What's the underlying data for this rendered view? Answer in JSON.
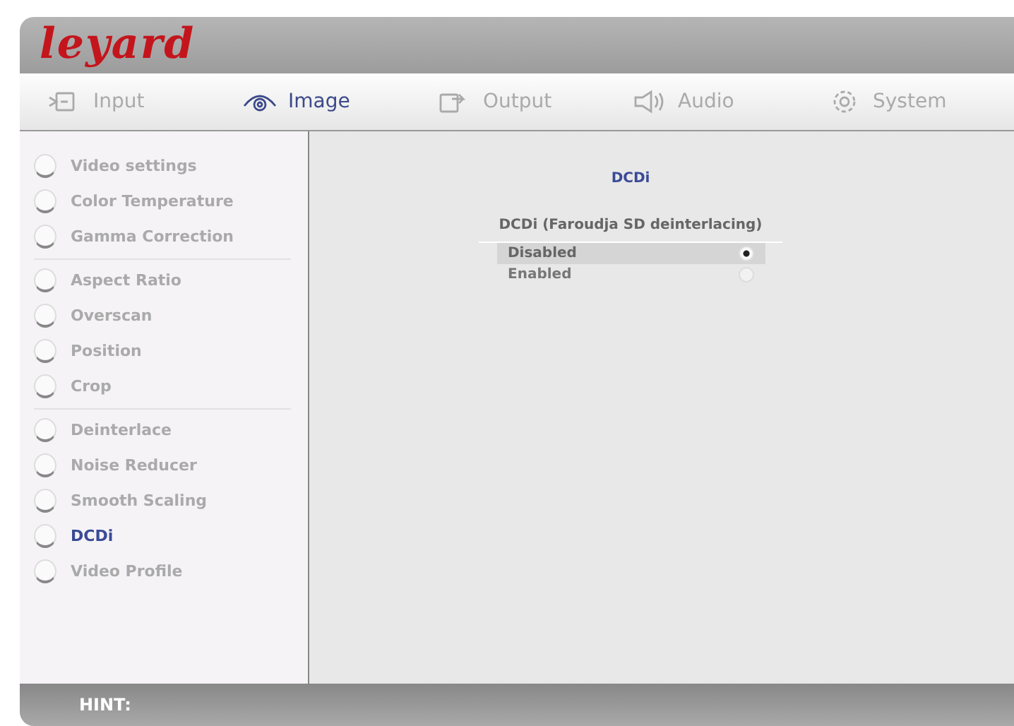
{
  "header": {
    "logo": "leyard"
  },
  "tabs": [
    {
      "label": "Input",
      "kind": "input",
      "selected": false
    },
    {
      "label": "Image",
      "kind": "eye",
      "selected": true
    },
    {
      "label": "Output",
      "kind": "output",
      "selected": false
    },
    {
      "label": "Audio",
      "kind": "speaker",
      "selected": false
    },
    {
      "label": "System",
      "kind": "gear",
      "selected": false
    }
  ],
  "sidebar": {
    "groups": [
      {
        "items": [
          {
            "label": "Video settings",
            "selected": false
          },
          {
            "label": "Color Temperature",
            "selected": false
          },
          {
            "label": "Gamma Correction",
            "selected": false
          }
        ]
      },
      {
        "items": [
          {
            "label": "Aspect Ratio",
            "selected": false
          },
          {
            "label": "Overscan",
            "selected": false
          },
          {
            "label": "Position",
            "selected": false
          },
          {
            "label": "Crop",
            "selected": false
          }
        ]
      },
      {
        "items": [
          {
            "label": "Deinterlace",
            "selected": false
          },
          {
            "label": "Noise Reducer",
            "selected": false
          },
          {
            "label": "Smooth Scaling",
            "selected": false
          },
          {
            "label": "DCDi",
            "selected": true
          },
          {
            "label": "Video Profile",
            "selected": false
          }
        ]
      }
    ]
  },
  "panel": {
    "title": "DCDi",
    "setting": "DCDi (Faroudja SD deinterlacing)",
    "options": [
      {
        "label": "Disabled",
        "selected": true
      },
      {
        "label": "Enabled",
        "selected": false
      }
    ]
  },
  "footer": {
    "hint_label": "HINT:"
  }
}
